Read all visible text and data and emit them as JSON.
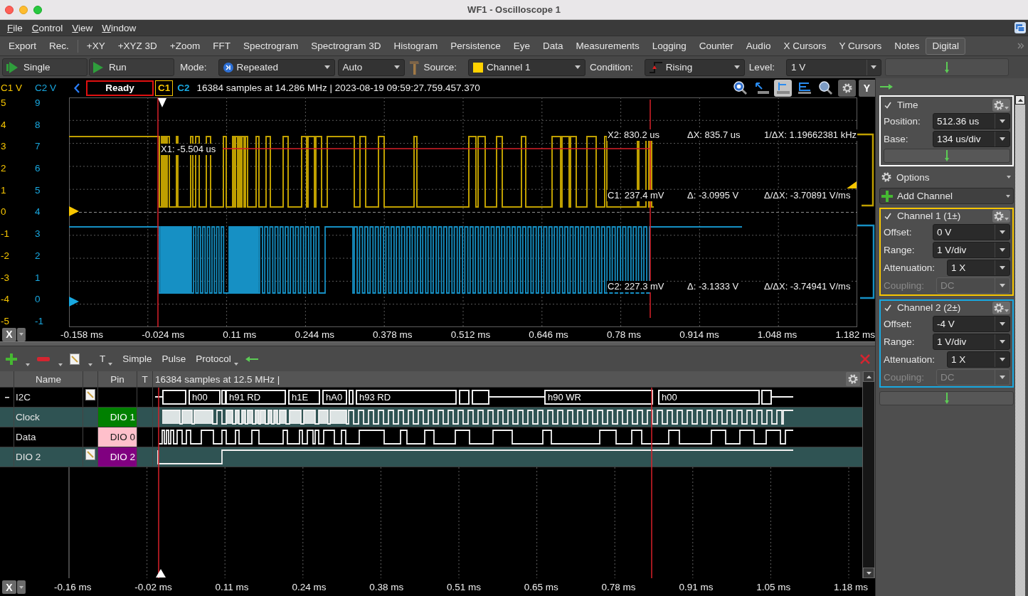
{
  "window": {
    "title": "WF1 - Oscilloscope 1"
  },
  "menu_bar": [
    "File",
    "Control",
    "View",
    "Window"
  ],
  "toolbar_groups": [
    {
      "items": [
        {
          "label": "Export",
          "selected": false
        },
        {
          "label": "Rec.",
          "selected": false
        }
      ]
    },
    {
      "items": [
        {
          "label": "+XY",
          "selected": false
        },
        {
          "label": "+XYZ 3D",
          "selected": false
        },
        {
          "label": "+Zoom",
          "selected": false
        },
        {
          "label": "FFT",
          "selected": false
        },
        {
          "label": "Spectrogram",
          "selected": false
        },
        {
          "label": "Spectrogram 3D",
          "selected": false
        },
        {
          "label": "Histogram",
          "selected": false
        },
        {
          "label": "Persistence",
          "selected": false
        },
        {
          "label": "Eye",
          "selected": false
        },
        {
          "label": "Data",
          "selected": false
        },
        {
          "label": "Measurements",
          "selected": false
        },
        {
          "label": "Logging",
          "selected": false
        },
        {
          "label": "Counter",
          "selected": false
        },
        {
          "label": "Audio",
          "selected": false
        },
        {
          "label": "X Cursors",
          "selected": false
        },
        {
          "label": "Y Cursors",
          "selected": false
        },
        {
          "label": "Notes",
          "selected": false
        },
        {
          "label": "Digital",
          "selected": true
        }
      ]
    }
  ],
  "controls": {
    "run_buttons": [
      {
        "kind": "single",
        "label": "Single"
      },
      {
        "kind": "run",
        "label": "Run"
      }
    ],
    "mode": {
      "label": "Mode:",
      "value": "Repeated"
    },
    "trigger_type": {
      "value": "Auto"
    },
    "source": {
      "label": "Source:",
      "value": "Channel 1"
    },
    "condition": {
      "label": "Condition:",
      "value": "Rising"
    },
    "level": {
      "label": "Level:",
      "value": "1 V"
    }
  },
  "scope": {
    "c1_axis": {
      "title": "C1 V",
      "labels": [
        "5",
        "4",
        "3",
        "2",
        "1",
        "0",
        "-1",
        "-2",
        "-3",
        "-4",
        "-5"
      ]
    },
    "c2_axis": {
      "title": "C2 V",
      "labels": [
        "9",
        "8",
        "7",
        "6",
        "5",
        "4",
        "3",
        "2",
        "1",
        "0",
        "-1"
      ]
    },
    "status": "Ready",
    "channel_tags": [
      {
        "label": "C1",
        "selected": true
      },
      {
        "label": "C2",
        "selected": false
      }
    ],
    "info": "16384 samples at 14.286 MHz | 2023-08-19 09:59:27.759.457.370",
    "tools": [
      {
        "kind": "zoom-reset",
        "selected": false
      },
      {
        "kind": "pointer",
        "selected": false
      },
      {
        "kind": "cursor",
        "selected": true
      },
      {
        "kind": "cursor-multi",
        "selected": false
      },
      {
        "kind": "zoom",
        "selected": false
      },
      {
        "kind": "settings",
        "selected": false
      }
    ],
    "y_button": "Y",
    "cursor_x1": "X1: -5.504 us",
    "readouts": [
      [
        "X2: 830.2 us",
        "ΔX: 835.7 us",
        "1/ΔX: 1.19662381 kHz"
      ],
      [
        "C1: 237.4 mV",
        "Δ: -3.0995 V",
        "Δ/ΔX: -3.70891 V/ms"
      ],
      [
        "C2: 227.3 mV",
        "Δ: -3.1333 V",
        "Δ/ΔX: -3.74941 V/ms"
      ]
    ],
    "time_axis": {
      "button": "X",
      "labels": [
        "-0.158 ms",
        "-0.024 ms",
        "0.11 ms",
        "0.244 ms",
        "0.378 ms",
        "0.512 ms",
        "0.646 ms",
        "0.78 ms",
        "0.914 ms",
        "1.048 ms",
        "1.182 ms"
      ]
    }
  },
  "side_panel": {
    "time": {
      "title": "Time",
      "checked": true,
      "fields": [
        {
          "label": "Position:",
          "value": "512.36 us",
          "disabled": false
        },
        {
          "label": "Base:",
          "value": "134 us/div",
          "disabled": false
        }
      ]
    },
    "options": "Options",
    "add_channel": "Add Channel",
    "channels": [
      {
        "title": "Channel 1 (1±)",
        "checked": true,
        "color": "#f7c600",
        "fields": [
          {
            "label": "Offset:",
            "value": "0 V",
            "disabled": false
          },
          {
            "label": "Range:",
            "value": "1 V/div",
            "disabled": false
          },
          {
            "label": "Attenuation:",
            "value": "1 X",
            "disabled": false
          },
          {
            "label": "Coupling:",
            "value": "DC",
            "disabled": true
          }
        ]
      },
      {
        "title": "Channel 2 (2±)",
        "checked": true,
        "color": "#18a8e0",
        "fields": [
          {
            "label": "Offset:",
            "value": "-4 V",
            "disabled": false
          },
          {
            "label": "Range:",
            "value": "1 V/div",
            "disabled": false
          },
          {
            "label": "Attenuation:",
            "value": "1 X",
            "disabled": false
          },
          {
            "label": "Coupling:",
            "value": "DC",
            "disabled": true
          }
        ]
      }
    ]
  },
  "logic": {
    "tools": [
      {
        "label": "T",
        "menu": true
      },
      {
        "label": "Simple",
        "menu": false
      },
      {
        "label": "Pulse",
        "menu": false
      },
      {
        "label": "Protocol",
        "menu": true
      }
    ],
    "columns": [
      "Name",
      "Pin",
      "T"
    ],
    "info": "16384 samples at 12.5 MHz |",
    "signals": [
      {
        "kind": "bus",
        "name": "I2C",
        "expanded": true,
        "note": true,
        "segments": [
          "h00",
          "h91 RD",
          "h1E",
          "hA0",
          "h93 RD",
          "h90 WR",
          "h00"
        ],
        "children": [
          {
            "kind": "signal",
            "name": "Clock",
            "pin": "DIO 1",
            "color": "#008000",
            "note": false
          },
          {
            "kind": "signal",
            "name": "Data",
            "pin": "DIO 0",
            "color": "#ffc0cb",
            "note": false
          }
        ]
      },
      {
        "kind": "signal",
        "name": "DIO 2",
        "pin": "DIO 2",
        "color": "#800080",
        "note": true
      }
    ],
    "time_axis": {
      "button": "X",
      "labels": [
        "-0.16 ms",
        "-0.02 ms",
        "0.11 ms",
        "0.24 ms",
        "0.38 ms",
        "0.51 ms",
        "0.65 ms",
        "0.78 ms",
        "0.91 ms",
        "1.05 ms",
        "1.18 ms"
      ]
    }
  }
}
